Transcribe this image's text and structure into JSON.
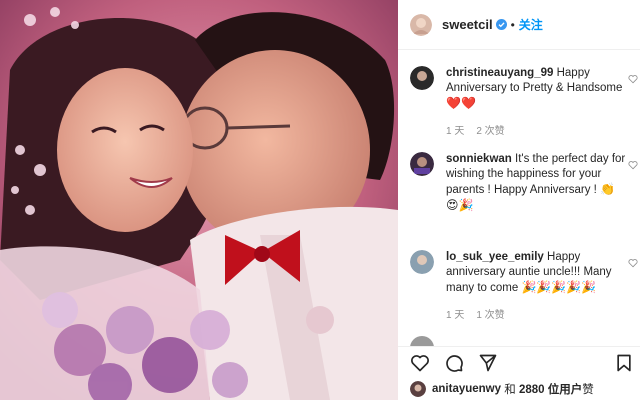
{
  "post": {
    "username": "sweetcil",
    "follow_label": "关注",
    "dot": "•"
  },
  "comments": [
    {
      "username": "christineauyang_99",
      "text": "Happy Anniversary to Pretty & Handsome",
      "emojis": "❤️❤️",
      "time": "1 天",
      "likes": "2 次赞"
    },
    {
      "username": "sonniekwan",
      "text": "It's the perfect day for wishing the happiness for your parents ! Happy Anniversary !",
      "emojis": "👏 😍🎉",
      "time": "",
      "likes": ""
    },
    {
      "username": "lo_suk_yee_emily",
      "text": "Happy anniversary auntie uncle!!! Many many to come",
      "emojis": "🎉🎉🎉🎉🎉",
      "time": "1 天",
      "likes": "1 次赞"
    }
  ],
  "likes_bar": {
    "liker": "anitayuenwy",
    "joiner": "和",
    "count": "2880 位用户",
    "suffix": "赞"
  },
  "colors": {
    "link_blue": "#0095f6",
    "heart_red": "#e8233c",
    "muted": "#8e8e8e"
  }
}
